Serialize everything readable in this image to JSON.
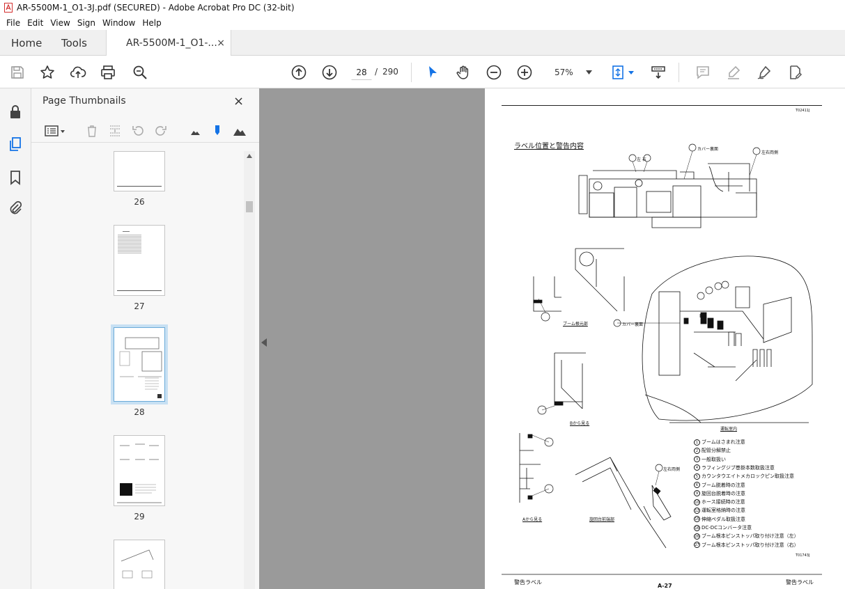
{
  "window": {
    "title": "AR-5500M-1_O1-3J.pdf (SECURED) - Adobe Acrobat Pro DC (32-bit)"
  },
  "menu": [
    "File",
    "Edit",
    "View",
    "Sign",
    "Window",
    "Help"
  ],
  "tabs": {
    "home": "Home",
    "tools": "Tools",
    "document": "AR-5500M-1_O1-...",
    "close_symbol": "×"
  },
  "toolbar": {
    "current_page": "28",
    "page_separator": "/",
    "total_pages": "290",
    "zoom": "57%"
  },
  "thumbnails_panel": {
    "title": "Page Thumbnails",
    "close_symbol": "×",
    "pages": [
      {
        "label": "26",
        "selected": false
      },
      {
        "label": "27",
        "selected": false
      },
      {
        "label": "28",
        "selected": true
      },
      {
        "label": "29",
        "selected": false
      },
      {
        "label": "",
        "selected": false
      }
    ]
  },
  "document_page": {
    "header_code": "T02411J",
    "section_title": "ラベル位置と警告内容",
    "callouts": {
      "left_right_top": "左  右",
      "cover_back_top": "カバー裏面",
      "left_right_side_top": "左右両側",
      "boom_base": "ブーム根元部",
      "cover_back_mid": "カバー裏面",
      "view_b": "Bから見る",
      "cab_interior": "運転室内",
      "left_right_side_bottom": "左右両側",
      "view_a": "Aから見る",
      "swing_frame_front": "旋回台前端部",
      "label_b": "B"
    },
    "legend": [
      {
        "num": "1",
        "text": "ブームはさまれ注意"
      },
      {
        "num": "2",
        "text": "配管分解禁止"
      },
      {
        "num": "3",
        "text": "一般取扱い"
      },
      {
        "num": "4",
        "text": "ラフィングジブ巻掛本数取扱注意"
      },
      {
        "num": "5",
        "text": "カウンタウエイトメカロックピン取扱注意"
      },
      {
        "num": "6",
        "text": "ブーム脱着時の注意"
      },
      {
        "num": "9",
        "text": "旋回台脱着時の注意"
      },
      {
        "num": "10",
        "text": "ホース接続時の注意"
      },
      {
        "num": "12",
        "text": "運転室格納時の注意"
      },
      {
        "num": "15",
        "text": "伸縮ペダル取扱注意"
      },
      {
        "num": "16",
        "text": "DC-DCコンバータ注意"
      },
      {
        "num": "26",
        "text": "ブーム根本ピンストッパ取り付け注意（左）"
      },
      {
        "num": "27",
        "text": "ブーム根本ピンストッパ取り付け注意（右）"
      }
    ],
    "figure_code": "T01743J",
    "footer_left": "警告ラベル",
    "footer_center": "A-27",
    "footer_right": "警告ラベル"
  },
  "colors": {
    "accent_blue": "#1473e6",
    "thumb_selected": "#c7e0f3",
    "viewer_bg": "#9a9a9a"
  }
}
